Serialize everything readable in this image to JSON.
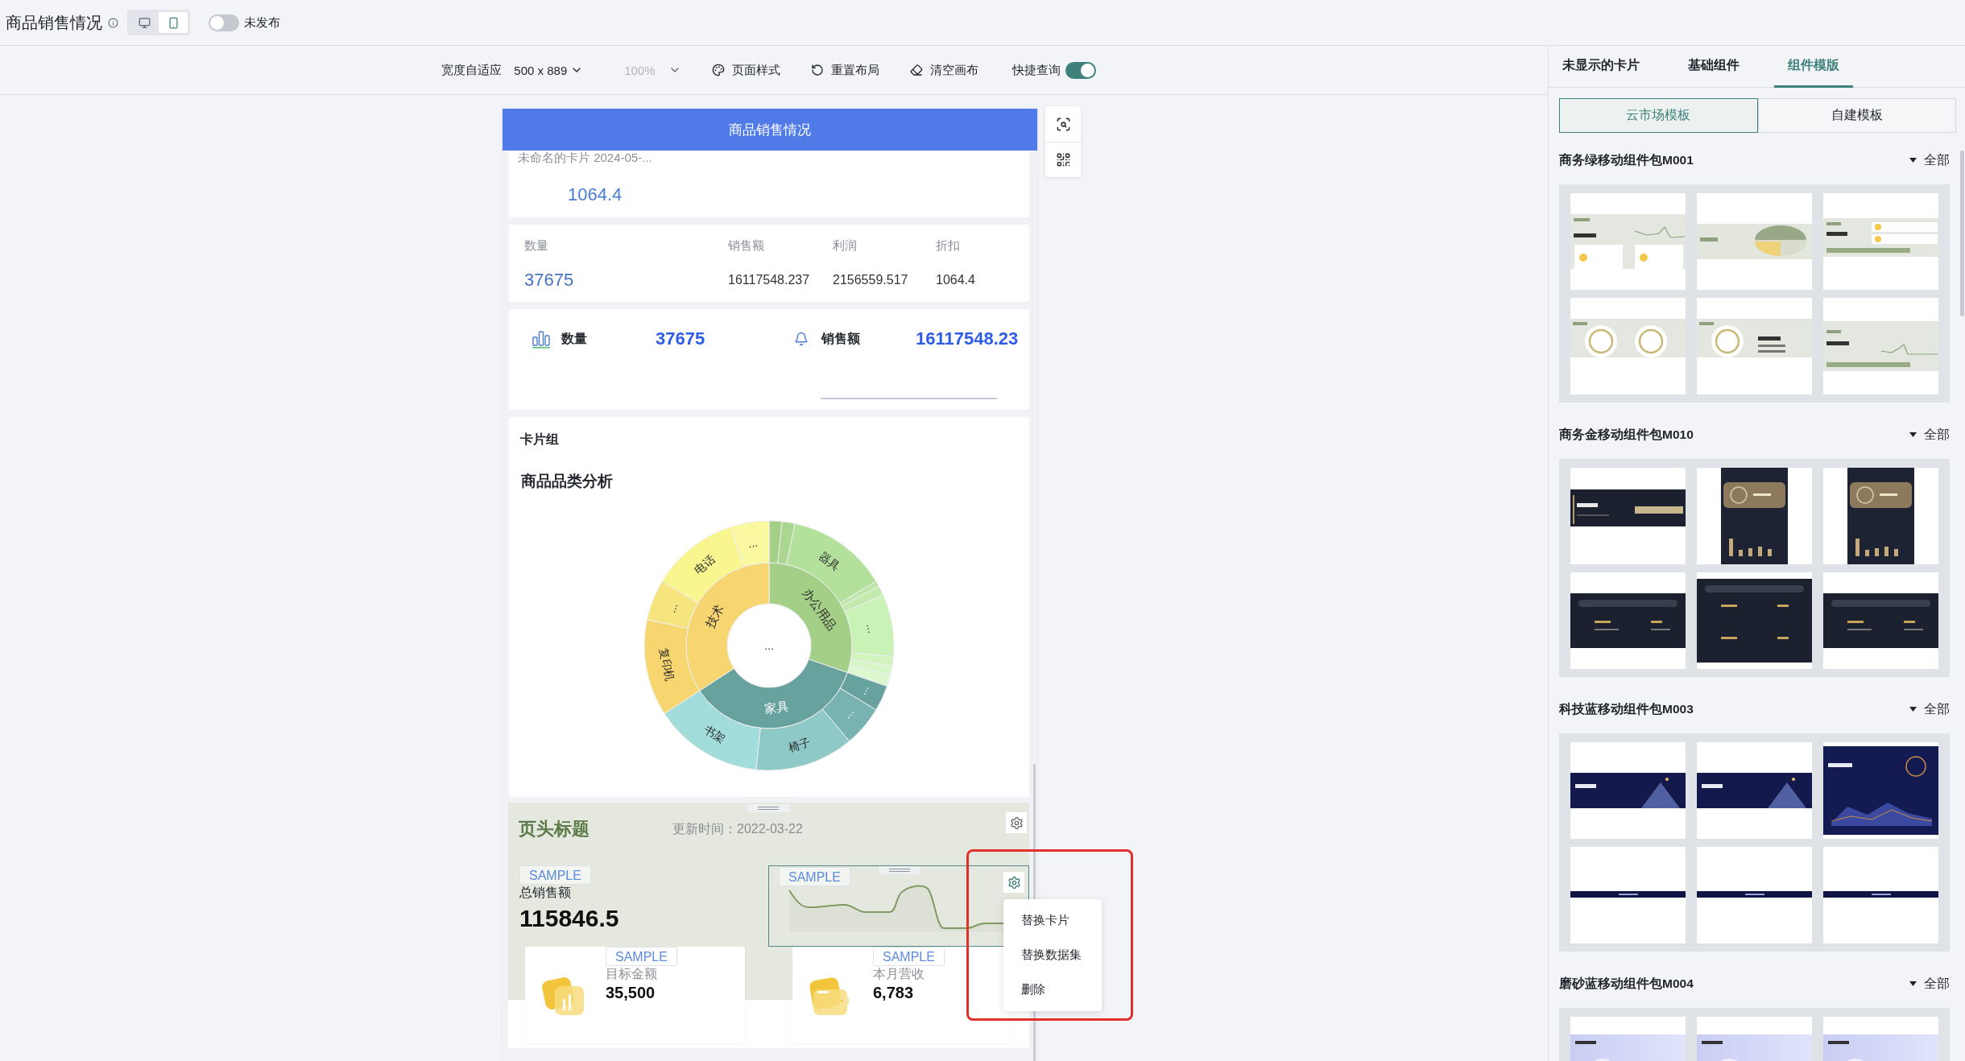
{
  "header": {
    "title": "商品销售情况",
    "device_modes": [
      {
        "kind": "desktop",
        "selected": false
      },
      {
        "kind": "mobile",
        "selected": true
      }
    ],
    "publish": {
      "label": "未发布",
      "on": false
    }
  },
  "toolbar": {
    "width_mode": "宽度自适应",
    "size": "500 x 889",
    "zoom": {
      "value": "100%",
      "disabled": true
    },
    "actions": [
      {
        "kind": "style",
        "label": "页面样式"
      },
      {
        "kind": "reset",
        "label": "重置布局"
      },
      {
        "kind": "clear",
        "label": "清空画布"
      }
    ],
    "quick_query": {
      "label": "快捷查询",
      "on": true
    }
  },
  "canvas": {
    "title": "商品销售情况",
    "summary_card": {
      "title": "未命名的卡片 2024-05-...",
      "value": "1064.4"
    },
    "metrics_card": {
      "columns": [
        "数量",
        "销售额",
        "利润",
        "折扣"
      ],
      "values": [
        "37675",
        "16117548.237",
        "2156559.517",
        "1064.4"
      ]
    },
    "kpi_card": [
      {
        "kind": "bars",
        "label": "数量",
        "value": "37675"
      },
      {
        "kind": "bell",
        "label": "销售额",
        "value": "16117548.23"
      }
    ],
    "card_group": {
      "title": "卡片组",
      "chart_title": "商品品类分析",
      "sunburst": {
        "center": "...",
        "segments": [
          {
            "label": "办公用品",
            "children": [
              {
                "label": "器具"
              },
              {
                "label": "..."
              }
            ]
          },
          {
            "label": "家具",
            "children": [
              {
                "label": "..."
              },
              {
                "label": "..."
              },
              {
                "label": "椅子"
              },
              {
                "label": "书架"
              }
            ]
          },
          {
            "label": "技术",
            "children": [
              {
                "label": "复印机"
              },
              {
                "label": "..."
              },
              {
                "label": "电话"
              },
              {
                "label": "..."
              }
            ]
          }
        ]
      }
    },
    "template_card": {
      "title": "页头标题",
      "updated": "更新时间：2022-03-22",
      "total": {
        "tag": "SAMPLE",
        "label": "总销售额",
        "value": "115846.5"
      },
      "chart": {
        "tag": "SAMPLE"
      },
      "tiles": [
        {
          "kind": "chart",
          "tag": "SAMPLE",
          "label": "目标金额",
          "value": "35,500"
        },
        {
          "kind": "wallet",
          "tag": "SAMPLE",
          "label": "本月营收",
          "value": "6,783"
        }
      ]
    },
    "context_menu": [
      "替换卡片",
      "替换数据集",
      "删除"
    ]
  },
  "panel": {
    "tabs": [
      {
        "label": "未显示的卡片",
        "selected": false
      },
      {
        "label": "基础组件",
        "selected": false
      },
      {
        "label": "组件模版",
        "selected": true
      }
    ],
    "sources": [
      {
        "label": "云市场模板",
        "selected": true
      },
      {
        "label": "自建模板",
        "selected": false
      }
    ],
    "packs": [
      {
        "name": "商务绿移动组件包M001",
        "filter": "全部",
        "thumbnails": [
          {
            "kind": "green-line"
          },
          {
            "kind": "green-pie"
          },
          {
            "kind": "green-stats"
          },
          {
            "kind": "green-gauges"
          },
          {
            "kind": "green-gauge-stats"
          },
          {
            "kind": "green-progress"
          }
        ]
      },
      {
        "name": "商务金移动组件包M010",
        "filter": "全部",
        "thumbnails": [
          {
            "kind": "gold-banner"
          },
          {
            "kind": "gold-tall"
          },
          {
            "kind": "gold-tall"
          },
          {
            "kind": "gold-panel"
          },
          {
            "kind": "gold-panel-tall"
          },
          {
            "kind": "gold-panel"
          }
        ]
      },
      {
        "name": "科技蓝移动组件包M003",
        "filter": "全部",
        "thumbnails": [
          {
            "kind": "navy-banner"
          },
          {
            "kind": "navy-banner"
          },
          {
            "kind": "navy-chart"
          },
          {
            "kind": "navy-strip"
          },
          {
            "kind": "navy-strip"
          },
          {
            "kind": "navy-strip"
          }
        ]
      },
      {
        "name": "磨砂蓝移动组件包M004",
        "filter": "全部",
        "thumbnails": [
          {
            "kind": "frost-banner"
          },
          {
            "kind": "frost-banner"
          },
          {
            "kind": "frost-banner"
          }
        ]
      }
    ]
  }
}
